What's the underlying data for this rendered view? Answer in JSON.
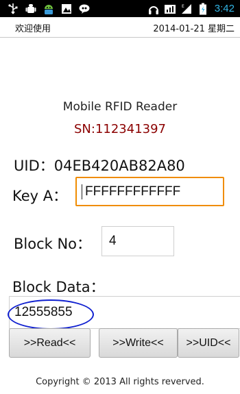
{
  "status_bar": {
    "time": "3:42",
    "icons": [
      "usb-icon",
      "android-debug-icon",
      "android-icon",
      "notification-icon",
      "voicemail-icon",
      "headphones-icon",
      "data-icon",
      "signal-icon",
      "battery-icon"
    ]
  },
  "header": {
    "app_title": "欢迎使用",
    "date": "2014-01-21 星期二"
  },
  "main": {
    "title": "Mobile RFID Reader",
    "serial": "SN:112341397",
    "uid_text": "UID：04EB420AB82A80",
    "key_a_label": "Key A：",
    "key_a_value": "FFFFFFFFFFFF",
    "block_no_label": "Block No：",
    "block_no_value": "4",
    "block_data_label": "Block Data：",
    "block_data_value": "12555855"
  },
  "buttons": {
    "read": ">>Read<<",
    "write": ">>Write<<",
    "uid": ">>UID<<"
  },
  "footer": {
    "copyright": "Copyright © 2013 All rights reverved."
  },
  "colors": {
    "serial_color": "#8b0000",
    "focus_border": "#f08c00",
    "annotation_ellipse": "#1020d0",
    "clock_color": "#33b5e5"
  }
}
